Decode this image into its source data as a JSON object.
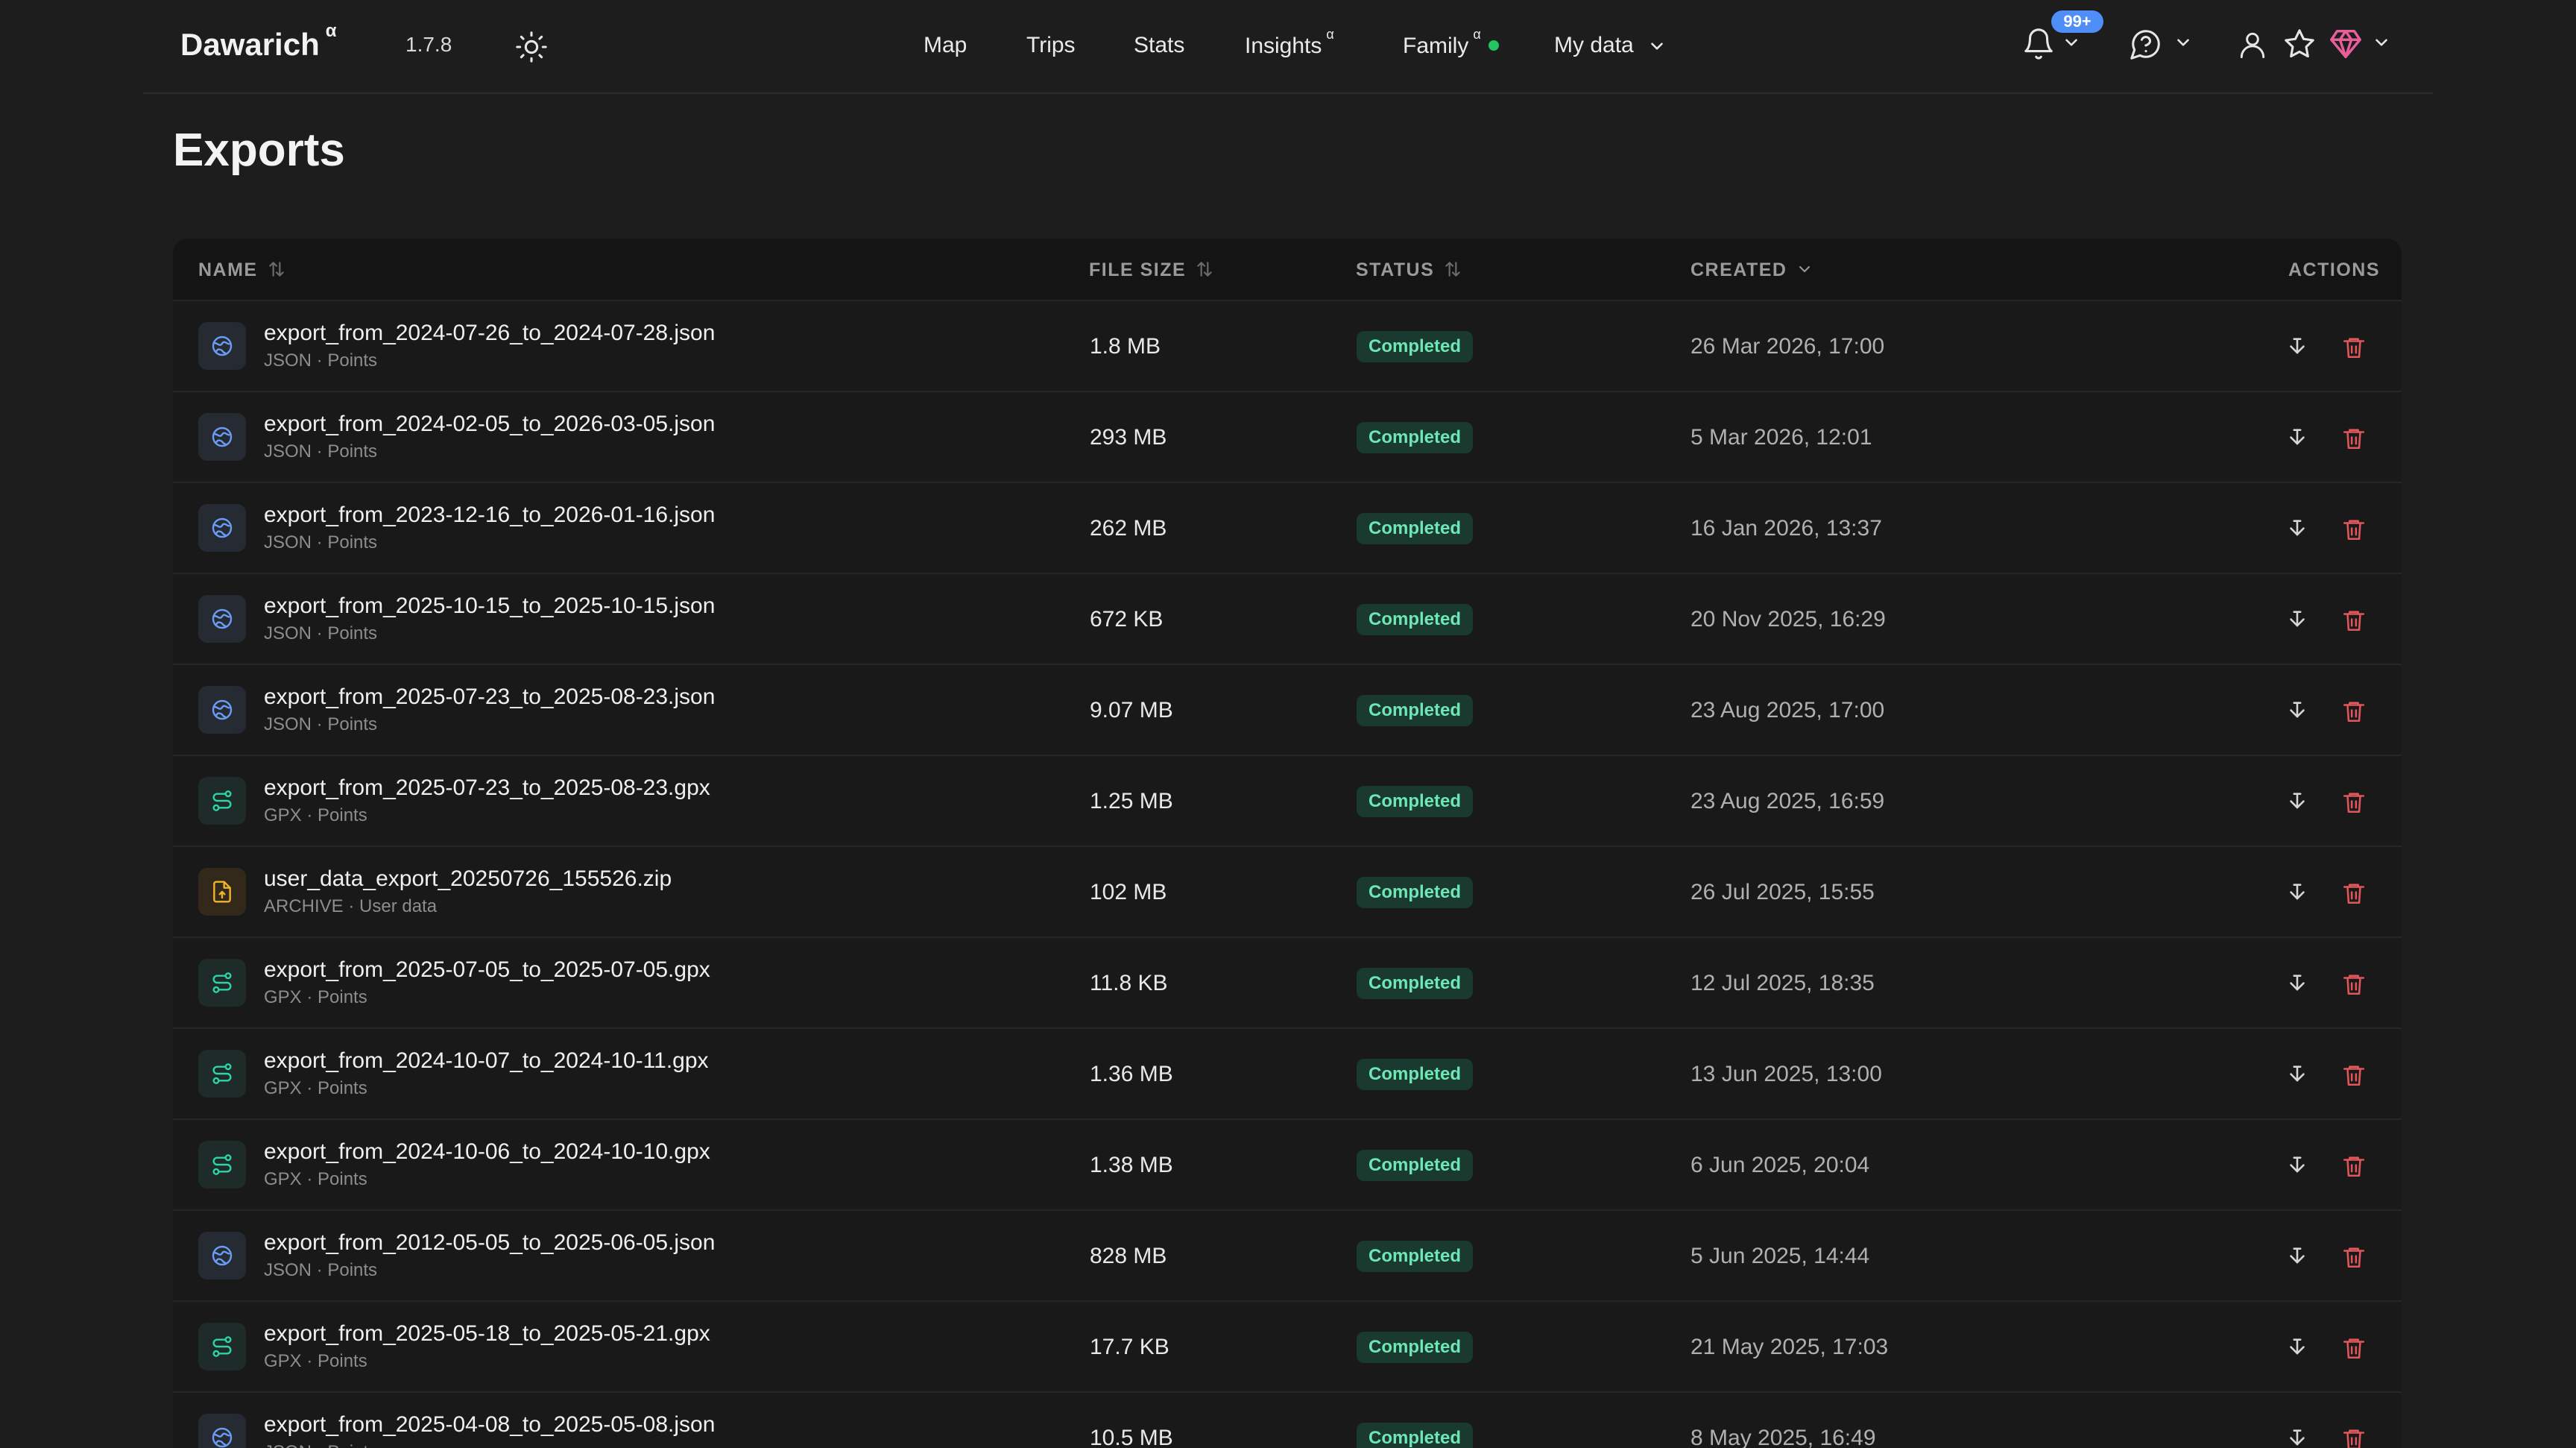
{
  "app": {
    "brand": "Dawarich",
    "brand_sup": "α",
    "version": "1.7.8"
  },
  "nav": {
    "map": "Map",
    "trips": "Trips",
    "stats": "Stats",
    "insights": "Insights",
    "insights_sup": "α",
    "family": "Family",
    "family_sup": "α",
    "my_data": "My data",
    "notifications_badge": "99+"
  },
  "page": {
    "title": "Exports"
  },
  "table": {
    "headers": {
      "name": "NAME",
      "file_size": "FILE SIZE",
      "status": "STATUS",
      "created": "CREATED",
      "actions": "ACTIONS"
    },
    "rows": [
      {
        "name": "export_from_2024-07-26_to_2024-07-28.json",
        "sub": "JSON · Points",
        "type": "json",
        "size": "1.8 MB",
        "status": "Completed",
        "created": "26 Mar 2026, 17:00"
      },
      {
        "name": "export_from_2024-02-05_to_2026-03-05.json",
        "sub": "JSON · Points",
        "type": "json",
        "size": "293 MB",
        "status": "Completed",
        "created": "5 Mar 2026, 12:01"
      },
      {
        "name": "export_from_2023-12-16_to_2026-01-16.json",
        "sub": "JSON · Points",
        "type": "json",
        "size": "262 MB",
        "status": "Completed",
        "created": "16 Jan 2026, 13:37"
      },
      {
        "name": "export_from_2025-10-15_to_2025-10-15.json",
        "sub": "JSON · Points",
        "type": "json",
        "size": "672 KB",
        "status": "Completed",
        "created": "20 Nov 2025, 16:29"
      },
      {
        "name": "export_from_2025-07-23_to_2025-08-23.json",
        "sub": "JSON · Points",
        "type": "json",
        "size": "9.07 MB",
        "status": "Completed",
        "created": "23 Aug 2025, 17:00"
      },
      {
        "name": "export_from_2025-07-23_to_2025-08-23.gpx",
        "sub": "GPX · Points",
        "type": "gpx",
        "size": "1.25 MB",
        "status": "Completed",
        "created": "23 Aug 2025, 16:59"
      },
      {
        "name": "user_data_export_20250726_155526.zip",
        "sub": "ARCHIVE · User data",
        "type": "zip",
        "size": "102 MB",
        "status": "Completed",
        "created": "26 Jul 2025, 15:55"
      },
      {
        "name": "export_from_2025-07-05_to_2025-07-05.gpx",
        "sub": "GPX · Points",
        "type": "gpx",
        "size": "11.8 KB",
        "status": "Completed",
        "created": "12 Jul 2025, 18:35"
      },
      {
        "name": "export_from_2024-10-07_to_2024-10-11.gpx",
        "sub": "GPX · Points",
        "type": "gpx",
        "size": "1.36 MB",
        "status": "Completed",
        "created": "13 Jun 2025, 13:00"
      },
      {
        "name": "export_from_2024-10-06_to_2024-10-10.gpx",
        "sub": "GPX · Points",
        "type": "gpx",
        "size": "1.38 MB",
        "status": "Completed",
        "created": "6 Jun 2025, 20:04"
      },
      {
        "name": "export_from_2012-05-05_to_2025-06-05.json",
        "sub": "JSON · Points",
        "type": "json",
        "size": "828 MB",
        "status": "Completed",
        "created": "5 Jun 2025, 14:44"
      },
      {
        "name": "export_from_2025-05-18_to_2025-05-21.gpx",
        "sub": "GPX · Points",
        "type": "gpx",
        "size": "17.7 KB",
        "status": "Completed",
        "created": "21 May 2025, 17:03"
      },
      {
        "name": "export_from_2025-04-08_to_2025-05-08.json",
        "sub": "JSON · Points",
        "type": "json",
        "size": "10.5 MB",
        "status": "Completed",
        "created": "8 May 2025, 16:49"
      }
    ]
  },
  "colors": {
    "background": "#1d1d1d",
    "status_bg": "#1a3a30",
    "status_text": "#6ee7b7",
    "json_icon": "#6b9cf5",
    "gpx_icon": "#2dd4a8",
    "zip_icon": "#f0b429",
    "delete": "#e0565b",
    "family_dot": "#22c55e",
    "badge": "#4f8ef7"
  }
}
